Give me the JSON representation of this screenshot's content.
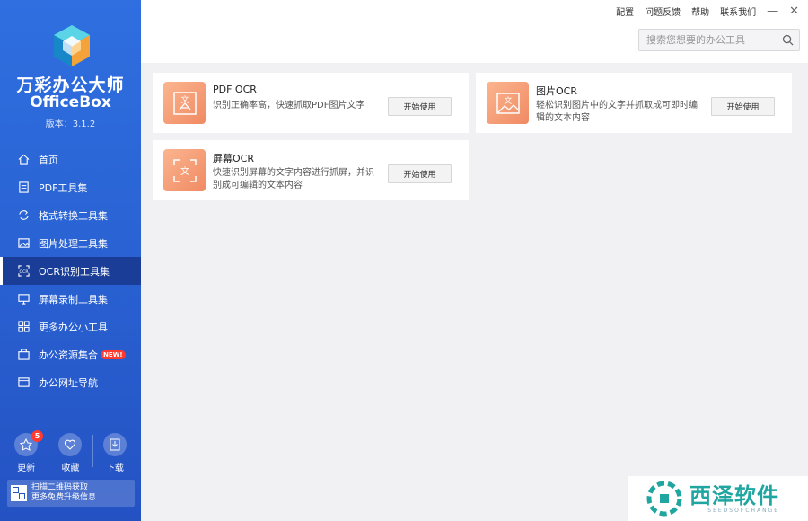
{
  "sidebar": {
    "brand_cn": "万彩办公大师",
    "brand_en": "OfficeBox",
    "version": "版本：3.1.2",
    "items": [
      {
        "label": "首页",
        "icon": "home-icon"
      },
      {
        "label": "PDF工具集",
        "icon": "pdf-icon"
      },
      {
        "label": "格式转换工具集",
        "icon": "convert-icon"
      },
      {
        "label": "图片处理工具集",
        "icon": "image-icon"
      },
      {
        "label": "OCR识别工具集",
        "icon": "ocr-icon",
        "active": true
      },
      {
        "label": "屏幕录制工具集",
        "icon": "monitor-icon"
      },
      {
        "label": "更多办公小工具",
        "icon": "grid-icon"
      },
      {
        "label": "办公资源集合",
        "icon": "resource-icon",
        "badge": "NEW!"
      },
      {
        "label": "办公网址导航",
        "icon": "browser-icon"
      }
    ],
    "bottom": [
      {
        "label": "更新",
        "icon": "update-icon",
        "badge": "5"
      },
      {
        "label": "收藏",
        "icon": "heart-icon"
      },
      {
        "label": "下载",
        "icon": "download-icon"
      }
    ],
    "promo": {
      "line1": "扫描二维码获取",
      "line2": "更多免费升级信息"
    }
  },
  "topbar": {
    "menu": [
      "配置",
      "问题反馈",
      "帮助",
      "联系我们"
    ],
    "minimize": "—",
    "close": "✕",
    "search_placeholder": "搜索您想要的办公工具"
  },
  "cards": [
    {
      "title": "PDF OCR",
      "desc": "识别正确率高，快速抓取PDF图片文字",
      "button": "开始使用",
      "icon": "pdf-ocr-icon"
    },
    {
      "title": "图片OCR",
      "desc": "轻松识别图片中的文字并抓取成可即时编辑的文本内容",
      "button": "开始使用",
      "icon": "image-ocr-icon"
    },
    {
      "title": "屏幕OCR",
      "desc": "快速识别屏幕的文字内容进行抓屏，并识别成可编辑的文本内容",
      "button": "开始使用",
      "icon": "screen-ocr-icon"
    }
  ],
  "watermark": {
    "cn": "西泽软件",
    "en": "SEEDSOFCHANGE"
  },
  "colors": {
    "sidebar": "#2a63d4",
    "active": "#1a3e97",
    "card_icon": "#f08a63",
    "badge": "#ff3b30"
  }
}
